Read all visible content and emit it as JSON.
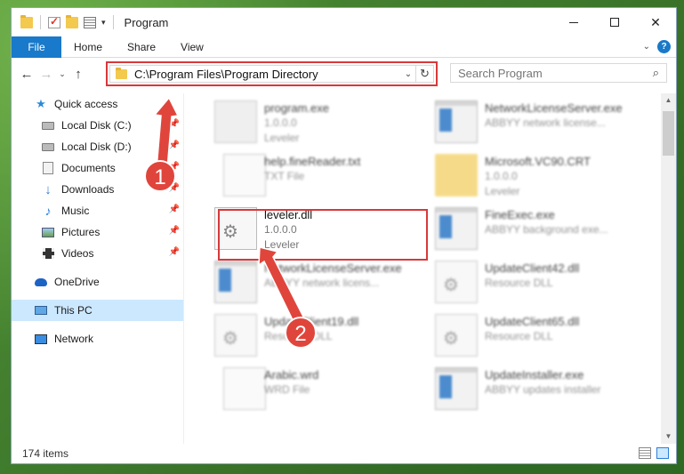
{
  "window": {
    "title": "Program",
    "minimize": "",
    "maximize": "",
    "close": "✕"
  },
  "ribbon": {
    "tabs": [
      "File",
      "Home",
      "Share",
      "View"
    ],
    "help": "?"
  },
  "navbar": {
    "address": "C:\\Program Files\\Program Directory",
    "search_placeholder": "Search Program"
  },
  "sidebar": {
    "items": [
      {
        "label": "Quick access",
        "icon": "star-icon",
        "pinned": false
      },
      {
        "label": "Local Disk (C:)",
        "icon": "disk-icon",
        "pinned": true
      },
      {
        "label": "Local Disk (D:)",
        "icon": "disk-icon",
        "pinned": true
      },
      {
        "label": "Documents",
        "icon": "documents-icon",
        "pinned": true
      },
      {
        "label": "Downloads",
        "icon": "download-icon",
        "pinned": true
      },
      {
        "label": "Music",
        "icon": "music-icon",
        "pinned": true
      },
      {
        "label": "Pictures",
        "icon": "pictures-icon",
        "pinned": true
      },
      {
        "label": "Videos",
        "icon": "videos-icon",
        "pinned": true
      },
      {
        "label": "OneDrive",
        "icon": "onedrive-icon",
        "pinned": false
      },
      {
        "label": "This PC",
        "icon": "this-pc-icon",
        "pinned": false,
        "selected": true
      },
      {
        "label": "Network",
        "icon": "network-icon",
        "pinned": false
      }
    ]
  },
  "files": [
    {
      "name": "program.exe",
      "desc1": "1.0.0.0",
      "desc2": "Leveler",
      "icon": "exe-icon",
      "blurred": true
    },
    {
      "name": "NetworkLicenseServer.exe",
      "desc1": "ABBYY network license...",
      "desc2": "",
      "icon": "app-window-icon",
      "blurred": true
    },
    {
      "name": "help.fineReader.txt",
      "desc1": "TXT File",
      "desc2": "",
      "icon": "text-file-icon",
      "blurred": true
    },
    {
      "name": "Microsoft.VC90.CRT",
      "desc1": "1.0.0.0",
      "desc2": "Leveler",
      "icon": "folder-icon",
      "blurred": true
    },
    {
      "name": "leveler.dll",
      "desc1": "1.0.0.0",
      "desc2": "Leveler",
      "icon": "dll-gear-icon",
      "blurred": false
    },
    {
      "name": "FineExec.exe",
      "desc1": "ABBYY background exe...",
      "desc2": "",
      "icon": "app-window-icon",
      "blurred": true
    },
    {
      "name": "NetworkLicenseServer.exe",
      "desc1": "ABBYY network licens...",
      "desc2": "",
      "icon": "app-window-icon",
      "blurred": true
    },
    {
      "name": "UpdateClient42.dll",
      "desc1": "Resource DLL",
      "desc2": "",
      "icon": "dll-gear-icon",
      "blurred": true
    },
    {
      "name": "UpdateClient19.dll",
      "desc1": "Resource DLL",
      "desc2": "",
      "icon": "dll-gear-icon",
      "blurred": true
    },
    {
      "name": "UpdateClient65.dll",
      "desc1": "Resource DLL",
      "desc2": "",
      "icon": "dll-gear-icon",
      "blurred": true
    },
    {
      "name": "Arabic.wrd",
      "desc1": "WRD File",
      "desc2": "",
      "icon": "text-file-icon",
      "blurred": true
    },
    {
      "name": "UpdateInstaller.exe",
      "desc1": "ABBYY updates installer",
      "desc2": "",
      "icon": "app-window-icon",
      "blurred": true
    }
  ],
  "status": {
    "count": "174 items"
  },
  "annotations": {
    "badge1": "1",
    "badge2": "2",
    "color": "#e0453c"
  }
}
